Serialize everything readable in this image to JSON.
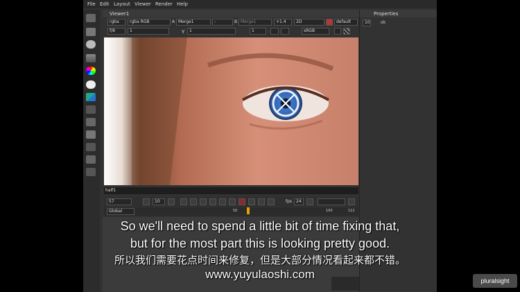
{
  "menu": [
    "File",
    "Edit",
    "Layout",
    "Viewer",
    "Render",
    "Help"
  ],
  "viewer": {
    "tab": "Viewer1",
    "channels": "rgba",
    "layer": "rgba RGB",
    "input_a_label": "A",
    "input_a": "Merge1",
    "op": "-",
    "input_b_label": "B",
    "input_b": "Merge1",
    "zoom": "+1.4",
    "mode": "2D",
    "lut_default": "default",
    "fstop": "f/8",
    "gain": "1",
    "gamma_label": "γ",
    "gamma": "1",
    "proxy": "1",
    "colorspace": "sRGB",
    "resolution": "half1"
  },
  "transport": {
    "frame": "57",
    "skip": "10",
    "fps_label": "fps",
    "fps": "24"
  },
  "timeline": {
    "mode": "Global",
    "ticks": [
      "50",
      "100",
      "112"
    ]
  },
  "properties": {
    "title": "Properties",
    "count": "10",
    "label": "ok"
  },
  "subtitles": {
    "line1": "So we'll need to spend a little bit of time fixing that,",
    "line2": "but for the most part this is looking pretty good.",
    "line3": "所以我们需要花点时间来修复，但是大部分情况看起来都不错。",
    "line4": "www.yuyulaoshi.com"
  },
  "brand": "pluralsight"
}
